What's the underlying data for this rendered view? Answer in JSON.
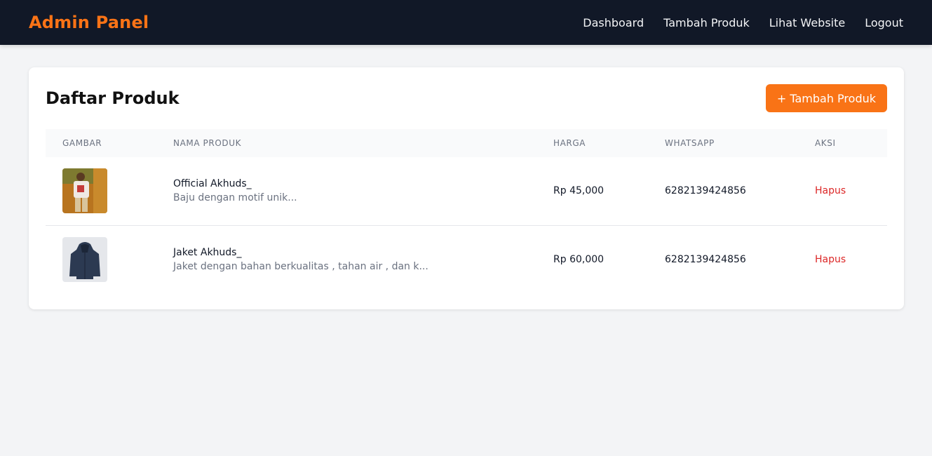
{
  "navbar": {
    "brand": "Admin Panel",
    "links": [
      "Dashboard",
      "Tambah Produk",
      "Lihat Website",
      "Logout"
    ]
  },
  "card": {
    "title": "Daftar Produk",
    "add_button": "+ Tambah Produk"
  },
  "table": {
    "headers": [
      "GAMBAR",
      "NAMA PRODUK",
      "HARGA",
      "WHATSAPP",
      "AKSI"
    ],
    "rows": [
      {
        "name": "Official Akhuds_",
        "description": "Baju dengan motif unik...",
        "price": "Rp 45,000",
        "whatsapp": "6282139424856",
        "action": "Hapus"
      },
      {
        "name": "Jaket Akhuds_",
        "description": "Jaket dengan bahan berkualitas , tahan air , dan k...",
        "price": "Rp 60,000",
        "whatsapp": "6282139424856",
        "action": "Hapus"
      }
    ]
  },
  "colors": {
    "accent": "#f97316",
    "navbar_bg": "#111827",
    "danger": "#dc2626"
  }
}
